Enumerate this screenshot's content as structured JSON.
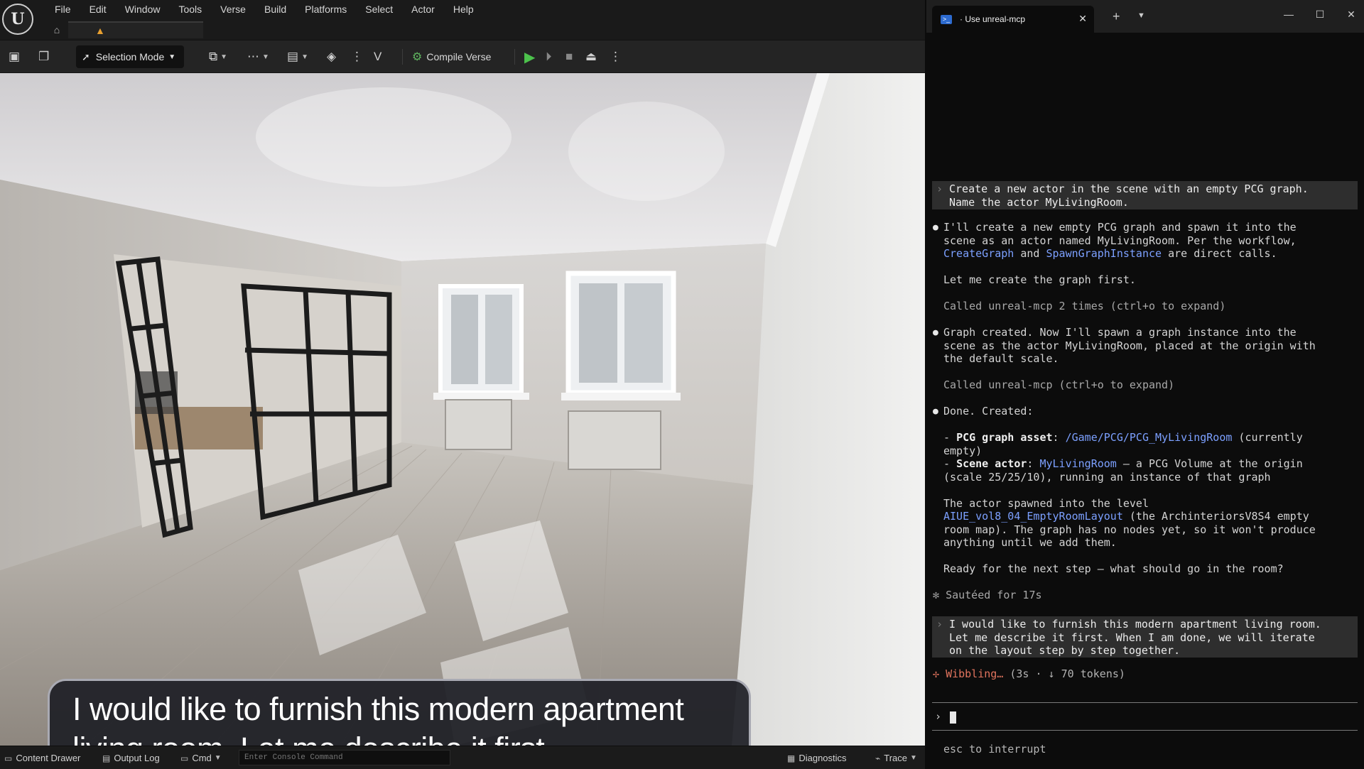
{
  "editor": {
    "logo_glyph": "U",
    "menus": [
      "File",
      "Edit",
      "Window",
      "Tools",
      "Verse",
      "Build",
      "Platforms",
      "Select",
      "Actor",
      "Help"
    ],
    "toolbar": {
      "selection_mode_label": "Selection Mode",
      "compile_verse_label": "Compile Verse"
    },
    "caption": "I would like to furnish this modern apartment living room. Let me describe it first.",
    "statusbar": {
      "content_drawer": "Content Drawer",
      "output_log": "Output Log",
      "cmd": "Cmd",
      "console_placeholder": "Enter Console Command",
      "diagnostics": "Diagnostics",
      "trace": "Trace"
    },
    "colors": {
      "accent_green": "#4cc24c",
      "level_tab_warning": "#e8a030"
    }
  },
  "terminal": {
    "tab_title": "· Use unreal-mcp",
    "user_prompt_1": [
      "Create a new actor in the scene with an empty PCG graph.",
      "Name the actor MyLivingRoom."
    ],
    "reply_1": {
      "line1": "I'll create a new empty PCG graph and spawn it into the",
      "line2": "scene as an actor named MyLivingRoom. Per the workflow,",
      "line3_link1": "CreateGraph",
      "line3_and": " and ",
      "line3_link2": "SpawnGraphInstance",
      "line3_rest": " are direct calls."
    },
    "reply_1b": "Let me create the graph first.",
    "called_1": "Called unreal-mcp 2 times (ctrl+o to expand)",
    "reply_2": [
      "Graph created. Now I'll spawn a graph instance into the",
      "scene as the actor MyLivingRoom, placed at the origin with",
      "the default scale."
    ],
    "called_2": "Called unreal-mcp (ctrl+o to expand)",
    "done": "Done. Created:",
    "item1": {
      "dash": "- ",
      "label": "PCG graph asset",
      "sep": ": ",
      "path": "/Game/PCG/PCG_MyLivingRoom",
      "rest": " (currently",
      "cont": "empty)"
    },
    "item2": {
      "dash": "- ",
      "label": "Scene actor",
      "sep": ": ",
      "name": "MyLivingRoom",
      "rest": " — a PCG Volume at the origin",
      "cont": "(scale 25/25/10), running an instance of that graph"
    },
    "level": {
      "line1": "The actor spawned into the level",
      "level_name": "AIUE_vol8_04_EmptyRoomLayout",
      "line2_rest": " (the ArchinteriorsV8S4 empty",
      "line3": "room map). The graph has no nodes yet, so it won't produce",
      "line4": "anything until we add them."
    },
    "ready": "Ready for the next step — what should go in the room?",
    "sauteed": "Sautéed for 17s",
    "user_prompt_2": [
      "I would like to furnish this modern apartment living room.",
      "Let me describe it first. When I am done, we will iterate",
      "on the layout step by step together."
    ],
    "status": {
      "word": "Wibbling…",
      "detail": " (3s · ↓ 70 tokens)"
    },
    "esc_hint": "esc to interrupt",
    "colors": {
      "link": "#7ca0ff",
      "status_orange": "#e2745e",
      "prompt_bg": "#2e2e2e"
    }
  }
}
